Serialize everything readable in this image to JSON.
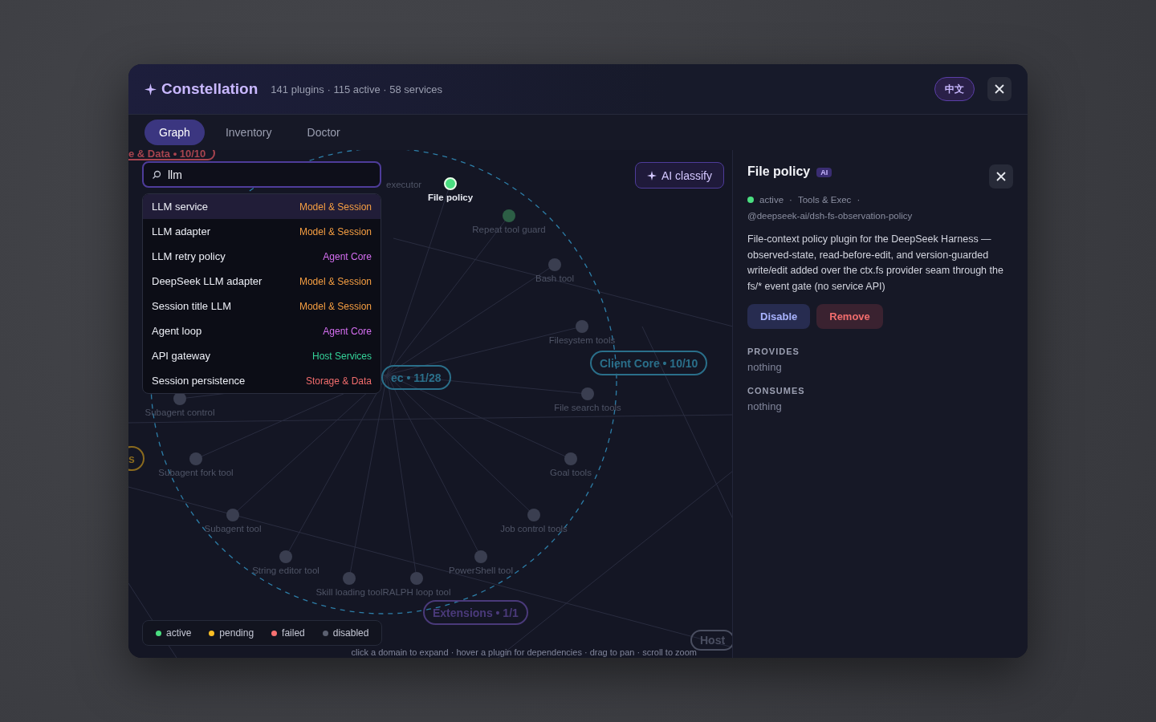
{
  "header": {
    "title": "Constellation",
    "stats": "141 plugins · 115 active · 58 services",
    "language": "中文"
  },
  "tabs": [
    {
      "label": "Graph",
      "selected": true
    },
    {
      "label": "Inventory",
      "selected": false
    },
    {
      "label": "Doctor",
      "selected": false
    }
  ],
  "graph": {
    "search": {
      "value": "llm"
    },
    "results": [
      {
        "name": "LLM service",
        "domain": "Model & Session",
        "color": "#f59e42",
        "selected": true
      },
      {
        "name": "LLM adapter",
        "domain": "Model & Session",
        "color": "#f59e42",
        "selected": false
      },
      {
        "name": "LLM retry policy",
        "domain": "Agent Core",
        "color": "#d46ef0",
        "selected": false
      },
      {
        "name": "DeepSeek LLM adapter",
        "domain": "Model & Session",
        "color": "#f59e42",
        "selected": false
      },
      {
        "name": "Session title LLM",
        "domain": "Model & Session",
        "color": "#f59e42",
        "selected": false
      },
      {
        "name": "Agent loop",
        "domain": "Agent Core",
        "color": "#d46ef0",
        "selected": false
      },
      {
        "name": "API gateway",
        "domain": "Host Services",
        "color": "#34d399",
        "selected": false
      },
      {
        "name": "Session persistence",
        "domain": "Storage & Data",
        "color": "#f26d6d",
        "selected": false
      }
    ],
    "ai_classify": "AI classify",
    "covered_label": "executor",
    "nodes": [
      {
        "label": "File policy",
        "color": "#4ade80",
        "focused": true
      },
      {
        "label": "Repeat tool guard",
        "color": "#2c5e45",
        "focused": false
      },
      {
        "label": "Bash tool",
        "color": "#3a3e50",
        "focused": false
      },
      {
        "label": "Filesystem tools",
        "color": "#3a3e50",
        "focused": false
      },
      {
        "label": "Subagent control",
        "color": "#3a3e50",
        "focused": false
      },
      {
        "label": "File search tools",
        "color": "#3a3e50",
        "focused": false
      },
      {
        "label": "Subagent fork tool",
        "color": "#3a3e50",
        "focused": false
      },
      {
        "label": "Goal tools",
        "color": "#3a3e50",
        "focused": false
      },
      {
        "label": "Subagent tool",
        "color": "#3a3e50",
        "focused": false
      },
      {
        "label": "Job control tools",
        "color": "#3a3e50",
        "focused": false
      },
      {
        "label": "String editor tool",
        "color": "#3a3e50",
        "focused": false
      },
      {
        "label": "PowerShell tool",
        "color": "#3a3e50",
        "focused": false
      },
      {
        "label": "Skill loading tool",
        "color": "#3a3e50",
        "focused": false
      },
      {
        "label": "RALPH loop tool",
        "color": "#3a3e50",
        "focused": false
      }
    ],
    "domains": [
      {
        "label": "e & Data • 10/10",
        "color": "#a8444f"
      },
      {
        "label": "Client Core • 10/10",
        "color": "#2a6f8a"
      },
      {
        "label": "ec • 11/28",
        "color": "#2a6f8a"
      },
      {
        "label": "s",
        "color": "#8a6a1e"
      },
      {
        "label": "Extensions • 1/1",
        "color": "#4a3a7a"
      },
      {
        "label": "Host",
        "color": "#4a4e60"
      }
    ],
    "legend": [
      {
        "label": "active",
        "color": "#4ade80"
      },
      {
        "label": "pending",
        "color": "#fbbf24"
      },
      {
        "label": "failed",
        "color": "#f87171"
      },
      {
        "label": "disabled",
        "color": "#5b6070"
      }
    ],
    "hint": "click a domain to expand · hover a plugin for dependencies · drag to pan · scroll to zoom"
  },
  "detail": {
    "title": "File policy",
    "badge": "AI",
    "status": "active",
    "color": "#4ade80",
    "domain": "Tools & Exec",
    "separator": "·",
    "package": "@deepseek-ai/dsh-fs-observation-policy",
    "description": "File-context policy plugin for the DeepSeek Harness — observed-state, read-before-edit, and version-guarded write/edit added over the ctx.fs provider seam through the fs/* event gate (no service API)",
    "buttons": [
      {
        "label": "Disable",
        "kind": "neutral"
      },
      {
        "label": "Remove",
        "kind": "danger"
      }
    ],
    "sections": [
      {
        "heading": "PROVIDES",
        "value": "nothing"
      },
      {
        "heading": "CONSUMES",
        "value": "nothing"
      }
    ]
  }
}
